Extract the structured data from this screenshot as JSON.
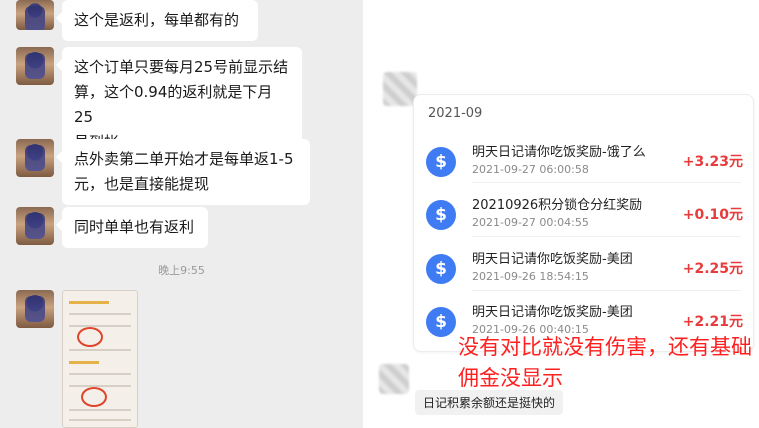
{
  "chat": {
    "messages": [
      {
        "text": "这个是返利，每单都有的"
      },
      {
        "text": "这个订单只要每月25号前显示结\n算，这个0.94的返利就是下月25\n号到帐"
      },
      {
        "text": "点外卖第二单开始才是每单返1-5\n元，也是直接能提现"
      },
      {
        "text": "同时单单也有返利"
      }
    ],
    "time": "晚上9:55"
  },
  "records": {
    "month": "2021-09",
    "items": [
      {
        "title": "明天日记请你吃饭奖励-饿了么",
        "date": "2021-09-27 06:00:58",
        "amount": "+3.23元"
      },
      {
        "title": "20210926积分锁仓分红奖励",
        "date": "2021-09-27 00:04:55",
        "amount": "+0.10元"
      },
      {
        "title": "明天日记请你吃饭奖励-美团",
        "date": "2021-09-26 18:54:15",
        "amount": "+2.25元"
      },
      {
        "title": "明天日记请你吃饭奖励-美团",
        "date": "2021-09-26 00:40:15",
        "amount": "+2.21元"
      }
    ],
    "icon_glyph": "$"
  },
  "annotation": "没有对比就没有伤害，还有基础佣金没显示",
  "reply": "日记积累余额还是挺快的",
  "colors": {
    "amount": "#e83b3b",
    "annotation": "#ff1f1f",
    "icon": "#3f7cf4",
    "chat_bg": "#ededed"
  }
}
